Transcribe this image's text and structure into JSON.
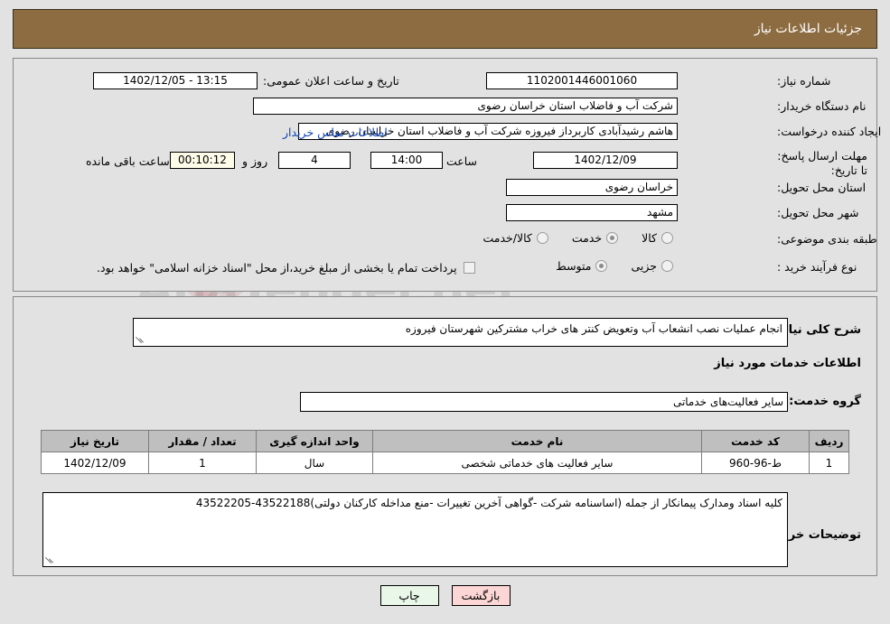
{
  "header": {
    "title": "جزئیات اطلاعات نیاز"
  },
  "watermark": {
    "text": "AnaTender.net"
  },
  "fields": {
    "need_number_label": "شماره نیاز:",
    "need_number_value": "1102001446001060",
    "announce_label": "تاریخ و ساعت اعلان عمومی:",
    "announce_value": "13:15 - 1402/12/05",
    "buyer_org_label": "نام دستگاه خریدار:",
    "buyer_org_value": "شرکت آب و فاضلاب استان خراسان رضوی",
    "creator_label": "ایجاد کننده درخواست:",
    "creator_value": "هاشم رشیدآبادی کاربرداز فیروزه  شرکت آب و فاضلاب استان خراسان رضوی",
    "contact_link": "اطلاعات تماس خریدار",
    "deadline_label": "مهلت ارسال پاسخ: تا تاریخ:",
    "deadline_date": "1402/12/09",
    "deadline_hour_label": "ساعت",
    "deadline_hour_value": "14:00",
    "days_value": "4",
    "days_label": "روز و",
    "countdown_value": "00:10:12",
    "countdown_label": "ساعت باقی مانده",
    "province_label": "استان محل تحویل:",
    "province_value": "خراسان رضوی",
    "city_label": "شهر محل تحویل:",
    "city_value": "مشهد",
    "category_label": "طبقه بندی موضوعی:",
    "process_label": "نوع فرآیند خرید :",
    "treasury_note": "پرداخت تمام یا بخشی از مبلغ خرید،از محل \"اسناد خزانه اسلامی\" خواهد بود."
  },
  "category_options": [
    {
      "label": "کالا",
      "selected": false
    },
    {
      "label": "خدمت",
      "selected": true
    },
    {
      "label": "کالا/خدمت",
      "selected": false
    }
  ],
  "process_options": [
    {
      "label": "جزیی",
      "selected": false
    },
    {
      "label": "متوسط",
      "selected": true
    }
  ],
  "description": {
    "label": "شرح کلی نیاز:",
    "value": "انجام عملیات نصب انشعاب آب وتعویض کنتر های خراب مشترکین شهرستان فیروزه"
  },
  "services_section": {
    "title": "اطلاعات خدمات مورد نیاز",
    "group_label": "گروه خدمت:",
    "group_value": "سایر فعالیت‌های خدماتی"
  },
  "table": {
    "headers": [
      "ردیف",
      "کد خدمت",
      "نام خدمت",
      "واحد اندازه گیری",
      "تعداد / مقدار",
      "تاریخ نیاز"
    ],
    "rows": [
      [
        "1",
        "ط-96-960",
        "سایر فعالیت های خدماتی شخصی",
        "سال",
        "1",
        "1402/12/09"
      ]
    ]
  },
  "buyer_notes": {
    "label": "توضیحات خریدار:",
    "value": "کلیه اسناد ومدارک پیمانکار از جمله (اساسنامه شرکت -گواهی آخرین تغییرات -منع مداخله کارکنان دولتی)43522188-43522205"
  },
  "buttons": {
    "print": "چاپ",
    "back": "بازگشت"
  }
}
